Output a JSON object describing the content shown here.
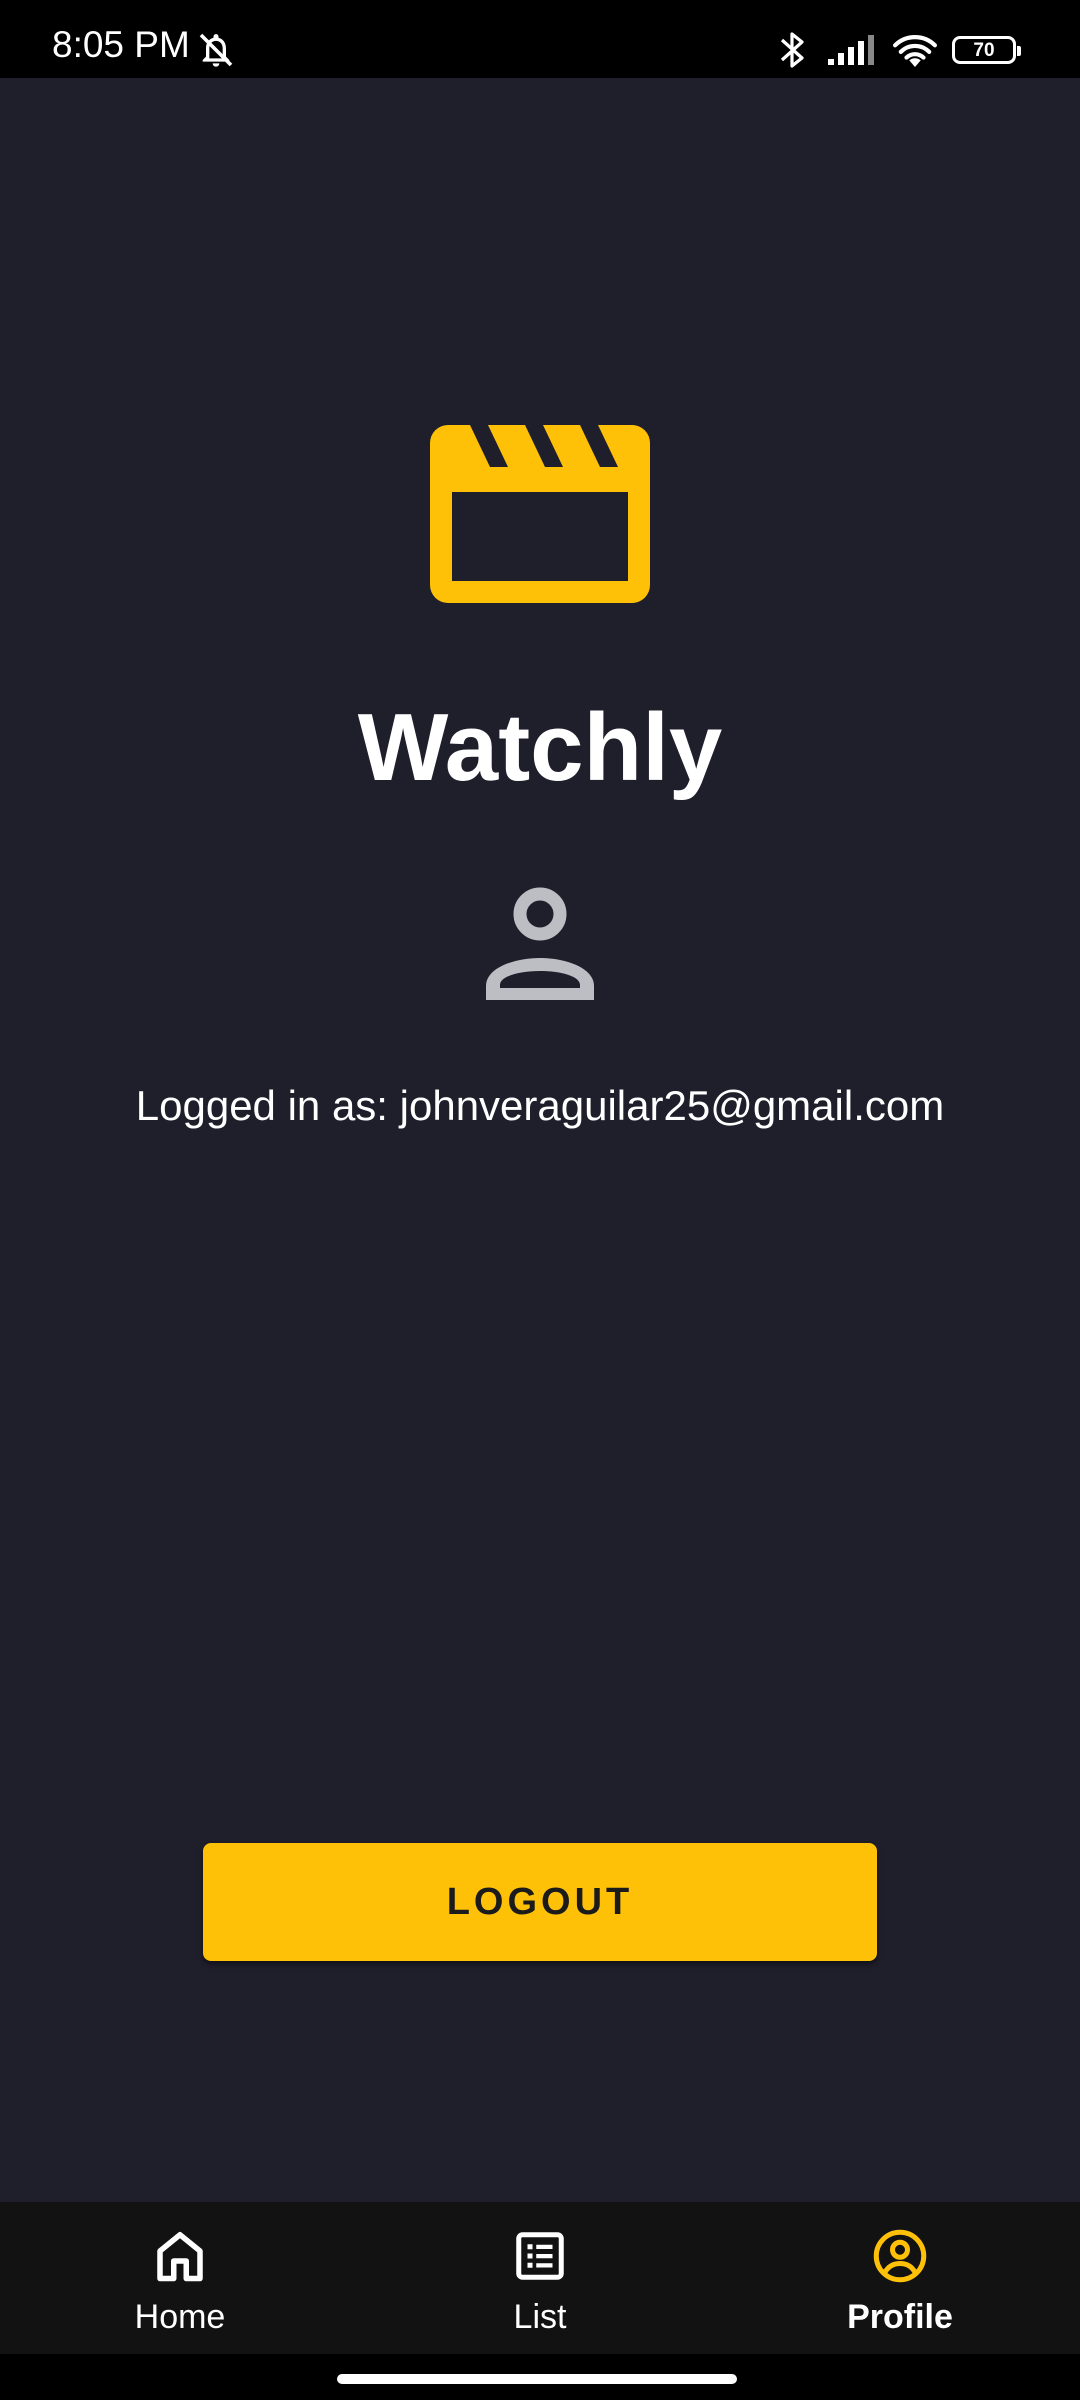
{
  "status_bar": {
    "time": "8:05 PM",
    "battery": "70",
    "icons": [
      "bell-off-icon",
      "bluetooth-icon",
      "signal-icon",
      "wifi-icon",
      "battery-icon"
    ]
  },
  "app": {
    "title": "Watchly",
    "logo_icon": "movie-clapperboard-icon",
    "accent_color": "#ffc107",
    "background_color": "#1f1e2b"
  },
  "profile": {
    "avatar_icon": "person-icon",
    "logged_in_text": "Logged in as: johnveraguilar25@gmail.com"
  },
  "actions": {
    "logout_label": "LOGOUT"
  },
  "bottom_nav": {
    "items": [
      {
        "label": "Home",
        "icon": "home-icon",
        "active": false
      },
      {
        "label": "List",
        "icon": "list-icon",
        "active": false
      },
      {
        "label": "Profile",
        "icon": "account-circle-icon",
        "active": true
      }
    ]
  }
}
